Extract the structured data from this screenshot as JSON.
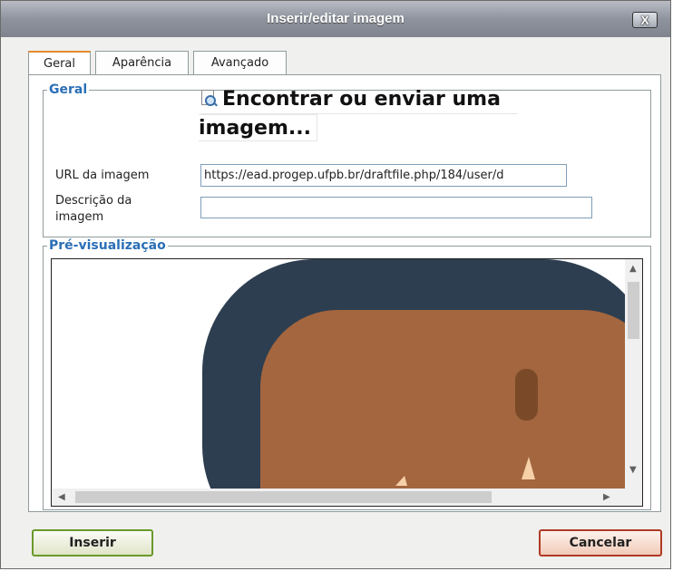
{
  "window": {
    "title": "Inserir/editar imagem",
    "close_glyph": "X"
  },
  "tabs": [
    {
      "label": "Geral",
      "active": true
    },
    {
      "label": "Aparência",
      "active": false
    },
    {
      "label": "Avançado",
      "active": false
    }
  ],
  "general": {
    "legend": "Geral",
    "finder_line1": "Encontrar ou enviar uma",
    "finder_line2": "imagem...",
    "finder_icon": "magnifier-icon",
    "url_label": "URL da imagem",
    "url_value": "https://ead.progep.ufpb.br/draftfile.php/184/user/d",
    "desc_label_line1": "Descrição da",
    "desc_label_line2": "imagem",
    "desc_value": ""
  },
  "preview": {
    "legend": "Pré-visualização",
    "colors": {
      "frame": "#2d3e50",
      "skin": "#a4663f",
      "eye": "#7a4a28",
      "highlight": "#f6d0a8"
    }
  },
  "buttons": {
    "insert_label": "Inserir",
    "cancel_label": "Cancelar"
  }
}
